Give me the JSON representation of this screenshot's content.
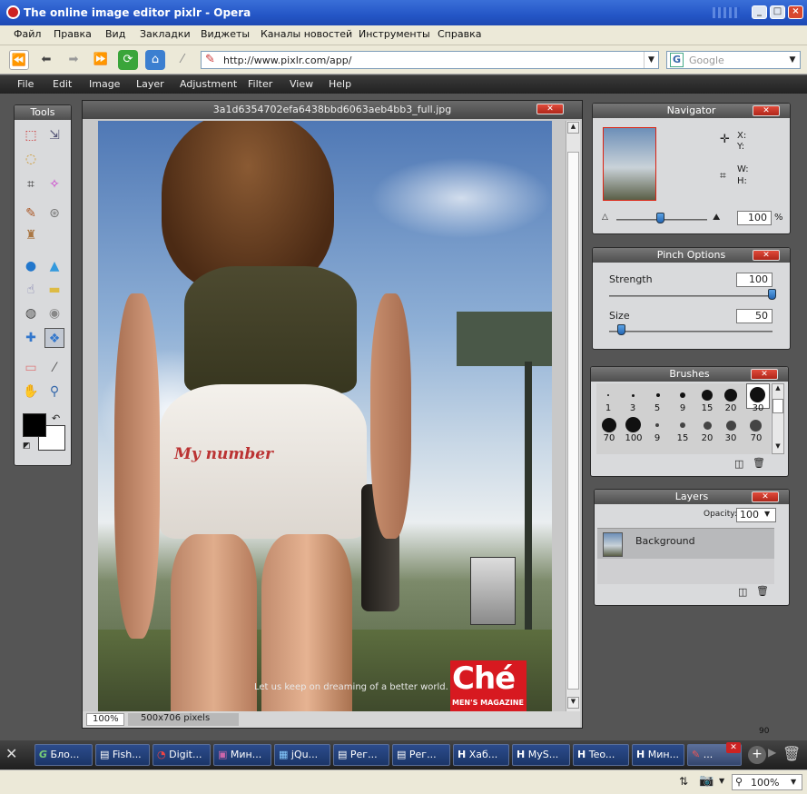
{
  "window": {
    "title": "The online image editor pixlr - Opera"
  },
  "browser_menu": [
    "Файл",
    "Правка",
    "Вид",
    "Закладки",
    "Виджеты",
    "Каналы новостей",
    "Инструменты",
    "Справка"
  ],
  "address": {
    "url": "http://www.pixlr.com/app/",
    "search_placeholder": "Google"
  },
  "app_menu": [
    "File",
    "Edit",
    "Image",
    "Layer",
    "Adjustment",
    "Filter",
    "View",
    "Help"
  ],
  "tools": {
    "title": "Tools"
  },
  "image_window": {
    "filename": "3a1d6354702efa6438bbd6063aeb4bb3_full.jpg",
    "zoom": "100%",
    "dimensions": "500x706 pixels"
  },
  "photo_text": {
    "skirt_text": "My number",
    "caption": "Let us keep on dreaming of a better world.",
    "brand": "Ché",
    "brand_sub": "MEN'S MAGAZINE"
  },
  "navigator": {
    "title": "Navigator",
    "x_label": "X:",
    "y_label": "Y:",
    "w_label": "W:",
    "h_label": "H:",
    "zoom_value": "100",
    "zoom_unit": "%"
  },
  "pinch": {
    "title": "Pinch Options",
    "strength_label": "Strength",
    "strength_value": "100",
    "strength_level": 1.0,
    "size_label": "Size",
    "size_value": "50",
    "size_level": 0.08
  },
  "brushes": {
    "title": "Brushes",
    "labels_row1": [
      "1",
      "3",
      "5",
      "9",
      "15",
      "20",
      "30"
    ],
    "labels_row2": [
      "70",
      "100",
      "9",
      "15",
      "20",
      "30",
      "70"
    ]
  },
  "layers": {
    "title": "Layers",
    "opacity_label": "Opacity:",
    "opacity_value": "100",
    "layer_name": "Background"
  },
  "misc": {
    "page_number": "90"
  },
  "taskbar": [
    "Бло...",
    "Fish...",
    "Digit...",
    "Мин...",
    "jQu...",
    "Рег...",
    "Рег...",
    "Хаб...",
    "MyS...",
    "Teo...",
    "Мин...",
    "..."
  ],
  "status": {
    "zoom": "100%"
  },
  "colors": {
    "accent": "#2456c6",
    "close": "#c22a1c",
    "fg_color": "#000000",
    "bg_color": "#ffffff"
  }
}
